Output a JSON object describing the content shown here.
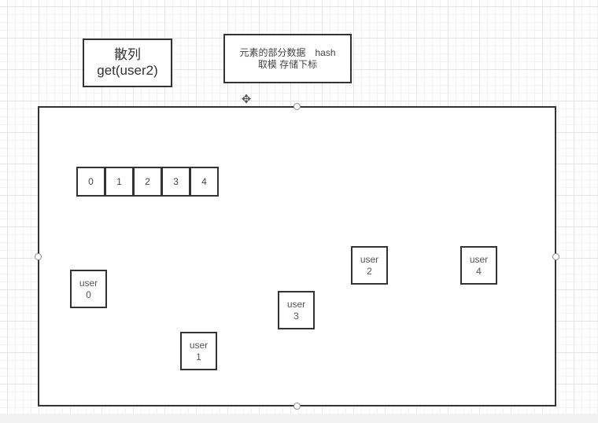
{
  "title_box": {
    "line1": "散列",
    "line2": "get(user2)"
  },
  "note_box": {
    "line1": "元素的部分数据　hash",
    "line2": "取模  存储下标"
  },
  "array": {
    "cells": [
      "0",
      "1",
      "2",
      "3",
      "4"
    ]
  },
  "users": [
    {
      "label": "user",
      "index": "0"
    },
    {
      "label": "user",
      "index": "1"
    },
    {
      "label": "user",
      "index": "2"
    },
    {
      "label": "user",
      "index": "3"
    },
    {
      "label": "user",
      "index": "4"
    }
  ],
  "cursor": {
    "icon": "move-cursor-icon",
    "glyph": "✥"
  }
}
